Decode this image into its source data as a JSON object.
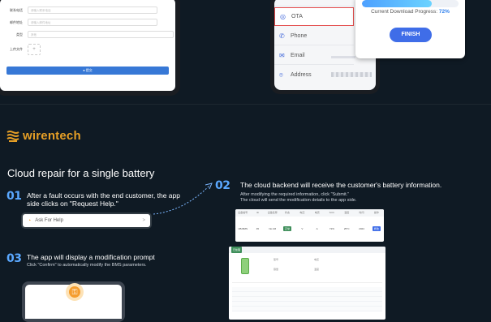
{
  "top_form": {
    "fields": [
      {
        "label": "联系电话",
        "placeholder": "请输入联系电话"
      },
      {
        "label": "邮件地址",
        "placeholder": "请输入邮件地址"
      },
      {
        "label": "类型",
        "value": "其他"
      },
      {
        "label": "上传文件",
        "upload": "+"
      }
    ],
    "submit_label": "● 提交"
  },
  "phone_menu": {
    "items": [
      {
        "label": "OTA",
        "icon": "globe-icon",
        "active": true
      },
      {
        "label": "Phone",
        "icon": "phone-icon",
        "active": false
      },
      {
        "label": "Email",
        "icon": "mail-icon",
        "active": false
      },
      {
        "label": "Address",
        "icon": "location-icon",
        "active": false
      }
    ]
  },
  "download": {
    "label": "Current Download Progress:",
    "percent_text": "72%",
    "progress": 0.72,
    "finish_label": "FINISH"
  },
  "brand": {
    "name": "wirentech",
    "color": "#e69f26"
  },
  "headline": "Cloud repair for a single battery",
  "steps": [
    {
      "num": "01",
      "title": "After a fault occurs with the end customer, the app side clicks on \"Request Help.\""
    },
    {
      "num": "02",
      "title": "The cloud backend will receive the customer's battery information.",
      "sub1": "After modifying the required information, click \"Submit.\"",
      "sub2": "The cloud will send the modification details to the app side."
    },
    {
      "num": "03",
      "title": "The app will display a modification prompt",
      "sub": "Click \"Confirm\" to automatically modify the BMS parameters."
    }
  ],
  "ask_button": {
    "label": "Ask For Help",
    "arrow": ">"
  },
  "backend_table": {
    "headers": [
      "设备编号",
      "ID",
      "设备名称",
      "状态",
      "电压",
      "电流",
      "SOC",
      "温度",
      "时间",
      "操作"
    ],
    "row": [
      "UB-BMS",
      "45",
      "No.1M",
      "正常",
      "V",
      "A",
      "72%",
      "25°C",
      "2024",
      "修改"
    ]
  },
  "detail_panel": {
    "tag": "已处理",
    "fields": [
      "型号",
      "电压",
      "容量",
      "温度"
    ]
  },
  "accent": "#5aa8ff"
}
